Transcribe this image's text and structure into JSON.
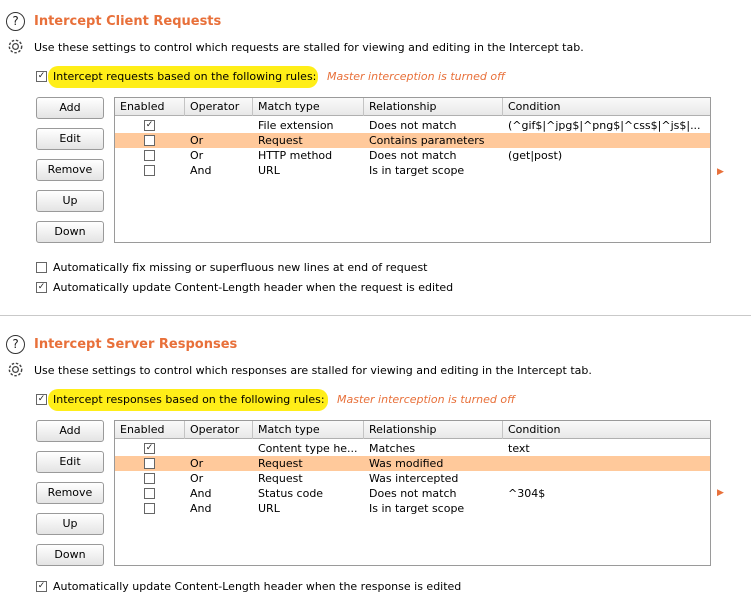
{
  "client": {
    "title": "Intercept Client Requests",
    "description": "Use these settings to control which requests are stalled for viewing and editing in the Intercept tab.",
    "rule_checkbox_label": "Intercept requests based on the following rules:",
    "rule_checkbox_checked": true,
    "master_note": "Master interception is turned off",
    "buttons": [
      "Add",
      "Edit",
      "Remove",
      "Up",
      "Down"
    ],
    "columns": [
      "Enabled",
      "Operator",
      "Match type",
      "Relationship",
      "Condition"
    ],
    "rows": [
      {
        "enabled": true,
        "operator": "",
        "match_type": "File extension",
        "relationship": "Does not match",
        "condition": "(^gif$|^jpg$|^png$|^css$|^js$|...",
        "selected": false
      },
      {
        "enabled": false,
        "operator": "Or",
        "match_type": "Request",
        "relationship": "Contains parameters",
        "condition": "",
        "selected": true
      },
      {
        "enabled": false,
        "operator": "Or",
        "match_type": "HTTP method",
        "relationship": "Does not match",
        "condition": "(get|post)",
        "selected": false
      },
      {
        "enabled": false,
        "operator": "And",
        "match_type": "URL",
        "relationship": "Is in target scope",
        "condition": "",
        "selected": false
      }
    ],
    "options": [
      {
        "label": "Automatically fix missing or superfluous new lines at end of request",
        "checked": false
      },
      {
        "label": "Automatically update Content-Length header when the request is edited",
        "checked": true
      }
    ]
  },
  "server": {
    "title": "Intercept Server Responses",
    "description": "Use these settings to control which responses are stalled for viewing and editing in the Intercept tab.",
    "rule_checkbox_label": "Intercept responses based on the following rules:",
    "rule_checkbox_checked": true,
    "master_note": "Master interception is turned off",
    "buttons": [
      "Add",
      "Edit",
      "Remove",
      "Up",
      "Down"
    ],
    "columns": [
      "Enabled",
      "Operator",
      "Match type",
      "Relationship",
      "Condition"
    ],
    "rows": [
      {
        "enabled": true,
        "operator": "",
        "match_type": "Content type he...",
        "relationship": "Matches",
        "condition": "text",
        "selected": false
      },
      {
        "enabled": false,
        "operator": "Or",
        "match_type": "Request",
        "relationship": "Was modified",
        "condition": "",
        "selected": true
      },
      {
        "enabled": false,
        "operator": "Or",
        "match_type": "Request",
        "relationship": "Was intercepted",
        "condition": "",
        "selected": false
      },
      {
        "enabled": false,
        "operator": "And",
        "match_type": "Status code",
        "relationship": "Does not match",
        "condition": "^304$",
        "selected": false
      },
      {
        "enabled": false,
        "operator": "And",
        "match_type": "URL",
        "relationship": "Is in target scope",
        "condition": "",
        "selected": false
      }
    ],
    "options": [
      {
        "label": "Automatically update Content-Length header when the response is edited",
        "checked": true
      }
    ]
  },
  "colors": {
    "accent": "#e8703a",
    "highlight": "#ffee18",
    "selected_row": "#ffc99b"
  },
  "icons": [
    "help-icon",
    "gear-icon",
    "expand-arrow-icon"
  ]
}
